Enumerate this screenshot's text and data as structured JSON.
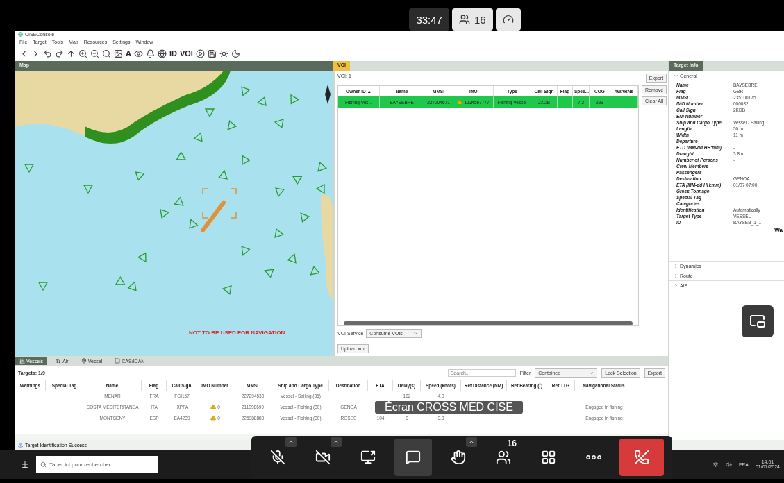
{
  "call": {
    "timer": "33:47",
    "participants": "16",
    "caption": "Écran CROSS MED CISE",
    "controls": [
      {
        "kind": "mic",
        "menu": true,
        "selected": false
      },
      {
        "kind": "camera",
        "menu": true,
        "selected": false
      },
      {
        "kind": "share",
        "menu": false,
        "selected": false
      },
      {
        "kind": "chat",
        "menu": false,
        "selected": true
      },
      {
        "kind": "hand",
        "menu": true,
        "selected": false
      },
      {
        "kind": "people",
        "menu": false,
        "selected": false,
        "badge": "16"
      },
      {
        "kind": "apps",
        "menu": false,
        "selected": false
      },
      {
        "kind": "more",
        "menu": false,
        "selected": false
      },
      {
        "kind": "leave",
        "menu": false,
        "selected": false
      }
    ]
  },
  "app": {
    "title": "CISEConsole",
    "menu": [
      "File",
      "Target",
      "Tools",
      "Map",
      "Resources",
      "Settings",
      "Window"
    ],
    "toolbar_labels": [
      "A",
      "ID",
      "VOI"
    ]
  },
  "map": {
    "tab": "Map",
    "warning": "NOT TO BE USED FOR NAVIGATION"
  },
  "voi": {
    "tab": "VOI",
    "title": "VOI: 1",
    "export": "Export",
    "columns": [
      "Owner ID ▲",
      "Name",
      "MMSI",
      "IMO",
      "Type",
      "Call Sign",
      "Flag",
      "Spee...",
      "COG",
      "#WARNs"
    ],
    "rows": [
      {
        "selected": true,
        "warning": true,
        "cells": [
          "Fishing Ves...",
          "BAYSEBRE",
          "227004671",
          "1234567777",
          "Fishing Vessel",
          "2XDB",
          null,
          "7.2",
          "293",
          null
        ]
      }
    ],
    "buttons": [
      "Remove",
      "Clear All"
    ],
    "service_label": "VOI Service",
    "service_value": "Consume VOIs",
    "upload": "Upload xml"
  },
  "details": {
    "tab": "Target Info",
    "sections": [
      {
        "title": "General",
        "expanded": true
      },
      {
        "title": "Dynamics",
        "expanded": false
      },
      {
        "title": "Route",
        "expanded": false
      },
      {
        "title": "AIS",
        "expanded": false
      }
    ],
    "fields": [
      {
        "label": "Name",
        "value": "BAYSEBRE"
      },
      {
        "label": "Flag",
        "value": "GBR"
      },
      {
        "label": "MMSI",
        "value": "235100175"
      },
      {
        "label": "IMO Number",
        "value": "000082"
      },
      {
        "label": "Call Sign",
        "value": "2KDB"
      },
      {
        "label": "ENI Number"
      },
      {
        "label": "Ship and Cargo Type",
        "value": "Vessel - Sailing"
      },
      {
        "label": "Length",
        "value": "50 m"
      },
      {
        "label": "Width",
        "value": "11 m"
      },
      {
        "label": "Departure"
      },
      {
        "label": "ETD (MM-dd HH:mm)",
        "value": "-"
      },
      {
        "label": "Draught",
        "value": "3.8 m"
      },
      {
        "label": "Number of Persons",
        "value": "-"
      },
      {
        "label": "Crew Members"
      },
      {
        "label": "Passengers",
        "value": "-"
      },
      {
        "label": "Destination",
        "value": "GENOA"
      },
      {
        "label": "ETA (MM-dd HH:mm)",
        "value": "01/07 07:00"
      },
      {
        "label": "Gross Tonnage"
      },
      {
        "label": "Special Tag"
      },
      {
        "label": "Categories"
      },
      {
        "label": "Identification",
        "value": "Automatically"
      },
      {
        "label": "Target Type",
        "value": "VESSEL"
      },
      {
        "label": "ID",
        "value": "BAYSEB_1_1"
      }
    ],
    "warnings_heading": "Wa"
  },
  "targets": {
    "tabs": [
      {
        "label": "Vessels",
        "selected": true
      },
      {
        "label": "Air",
        "selected": false
      },
      {
        "label": "Vessel",
        "selected": false
      },
      {
        "label": "CAS/ICAN",
        "selected": false
      }
    ],
    "title": "Targets: 1/9",
    "search": {
      "placeholder": "Search..."
    },
    "filter_label": "Filter",
    "filter_value": "Contained",
    "lock": "Lock Selection",
    "export": "Export",
    "columns": [
      "Warnings",
      "Special Tag",
      "Name",
      "Flag",
      "Call Sign",
      "IMO Number",
      "MMSI",
      "Ship and Cargo Type",
      "Destination",
      "ETA",
      "Delay(s)",
      "Speed (knots)",
      "Ref Distance (NM)",
      "Ref Bearing (°)",
      "Ref TTG",
      "Navigational Status"
    ],
    "rows": [
      {
        "warning": false,
        "cells": [
          null,
          null,
          "MENAR",
          "FRA",
          "FGI157",
          null,
          "227294530",
          "Vessel - Sailing (36)",
          null,
          null,
          "182",
          "4.0",
          null,
          null,
          null,
          null
        ]
      },
      {
        "warning": true,
        "cells": [
          null,
          null,
          "COSTA MEDITERRANEA",
          "ITA",
          "IXPPA",
          "0",
          "211098690",
          "Vessel - Fishing (30)",
          "GENOA",
          null,
          null,
          null,
          null,
          null,
          null,
          "Engaged in fishing"
        ]
      },
      {
        "warning": true,
        "cells": [
          null,
          null,
          "MONTSENY",
          "ESP",
          "EA4239",
          "0",
          "225988880",
          "Vessel - Fishing (30)",
          "ROSES",
          "104",
          "0",
          "3.3",
          null,
          null,
          null,
          "Engaged in fishing"
        ]
      }
    ]
  },
  "status": "Target Identification Success",
  "taskbar": {
    "search": {
      "placeholder": "Taper ici pour rechercher"
    },
    "lang": "FRA",
    "time": "14:01",
    "date": "01/07/2024"
  }
}
